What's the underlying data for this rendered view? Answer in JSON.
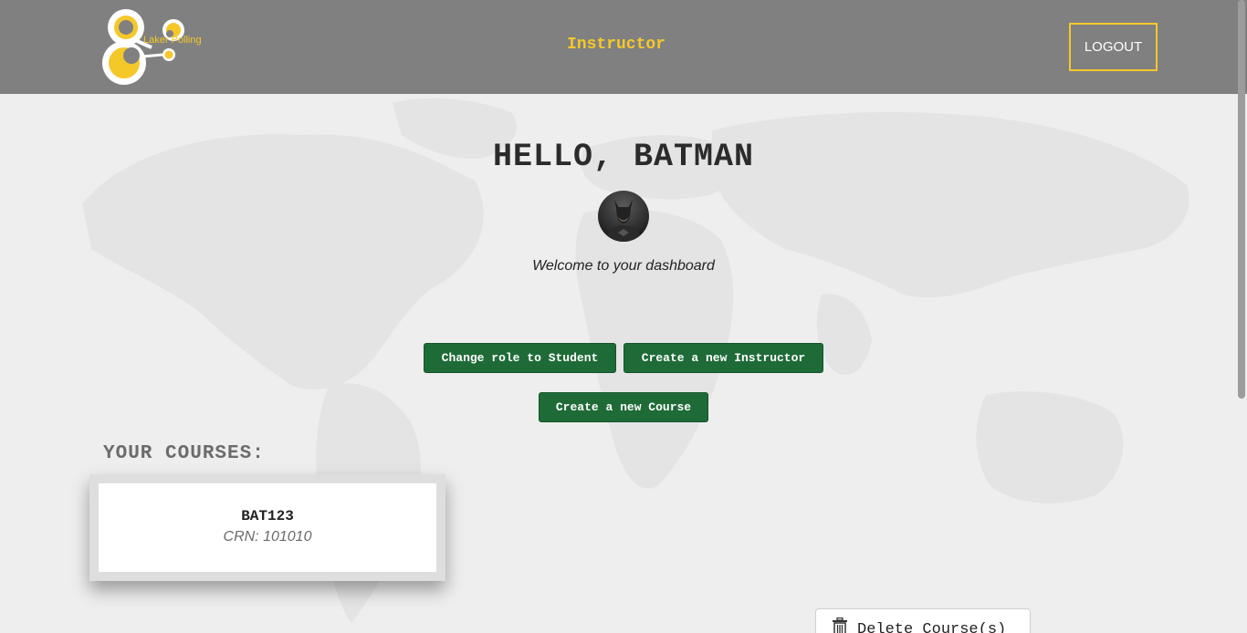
{
  "header": {
    "logo_text": "Laker Polling",
    "role_title": "Instructor",
    "logout_label": "LOGOUT"
  },
  "dashboard": {
    "greeting": "HELLO, BATMAN",
    "welcome": "Welcome to your dashboard",
    "buttons": {
      "change_role": "Change role to Student",
      "new_instructor": "Create a new Instructor",
      "new_course": "Create a new Course"
    }
  },
  "courses": {
    "heading": "YOUR COURSES:",
    "items": [
      {
        "code": "BAT123",
        "crn": "CRN: 101010"
      }
    ],
    "delete_label": "Delete Course(s)"
  },
  "colors": {
    "header_bg": "#808080",
    "accent_yellow": "#f5c82a",
    "button_green": "#1e6b38",
    "page_bg": "#eeeeee"
  }
}
